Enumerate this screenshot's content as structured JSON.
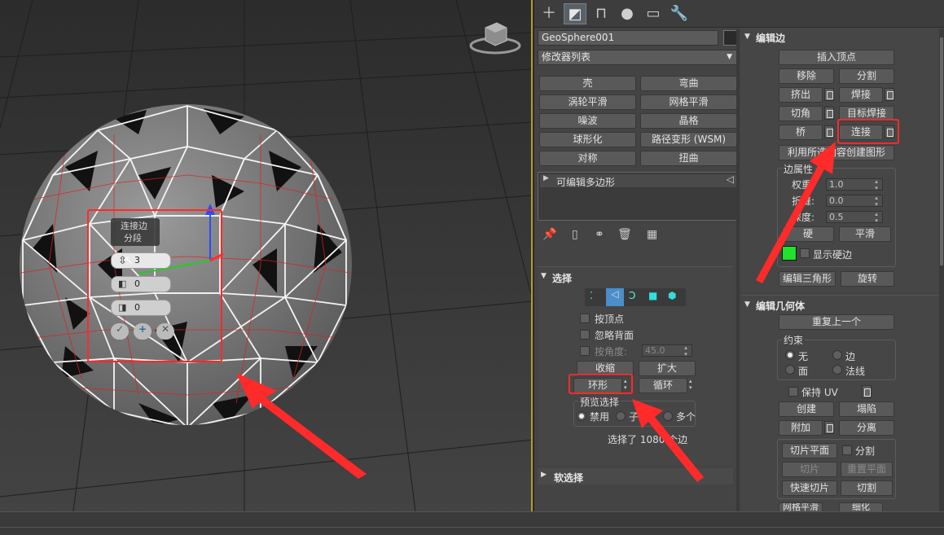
{
  "command_tabs": [
    "create-icon",
    "modify-icon",
    "hierarchy-icon",
    "motion-icon",
    "display-icon",
    "utilities-icon"
  ],
  "object": {
    "name": "GeoSphere001",
    "color": "#2a2a2a"
  },
  "modifier_list": {
    "label": "修改器列表",
    "buttons": [
      "壳",
      "弯曲",
      "涡轮平滑",
      "网格平滑",
      "噪波",
      "晶格",
      "球形化",
      "路径变形 (WSM)",
      "对称",
      "扭曲"
    ]
  },
  "stack": {
    "item": "可编辑多边形"
  },
  "viewport_caddy": {
    "title": "连接边",
    "subtitle": "分段",
    "fields": [
      "3",
      "0",
      "0"
    ]
  },
  "selection": {
    "title": "选择",
    "by_vertex": "按顶点",
    "ignore_backfacing": "忽略背面",
    "by_angle": "按角度:",
    "angle_value": "45.0",
    "shrink": "收缩",
    "grow": "扩大",
    "ring": "环形",
    "loop": "循环",
    "preview_label": "预览选择",
    "preview_options": [
      "禁用",
      "子",
      "多个"
    ],
    "status": "选择了 1080 个边"
  },
  "soft_selection": {
    "title": "软选择"
  },
  "edit_edges": {
    "title": "编辑边",
    "insert_vertex": "插入顶点",
    "remove": "移除",
    "split": "分割",
    "extrude": "挤出",
    "weld": "焊接",
    "chamfer": "切角",
    "target_weld": "目标焊接",
    "bridge": "桥",
    "connect": "连接",
    "create_shape": "利用所选内容创建图形",
    "edge_props": "边属性",
    "weight_label": "权重:",
    "weight": "1.0",
    "crease_label": "折缝:",
    "crease": "0.0",
    "depth_label": "深度:",
    "depth": "0.5",
    "hard": "硬",
    "smooth": "平滑",
    "show_hard": "显示硬边",
    "hard_color": "#22e02e",
    "edit_tri": "编辑三角形",
    "turn": "旋转"
  },
  "edit_geometry": {
    "title": "编辑几何体",
    "repeat_last": "重复上一个",
    "constraints": "约束",
    "c_none": "无",
    "c_edge": "边",
    "c_face": "面",
    "c_normal": "法线",
    "preserve_uv": "保持 UV",
    "create": "创建",
    "collapse": "塌陷",
    "attach": "附加",
    "detach": "分离",
    "slice_plane": "切片平面",
    "split": "分割",
    "slice": "切片",
    "reset_plane": "重置平面",
    "quickslice": "快速切片",
    "cut": "切割",
    "msmooth": "网格平滑",
    "tessellate": "细化"
  },
  "annotation_color": "#ff2a2a"
}
